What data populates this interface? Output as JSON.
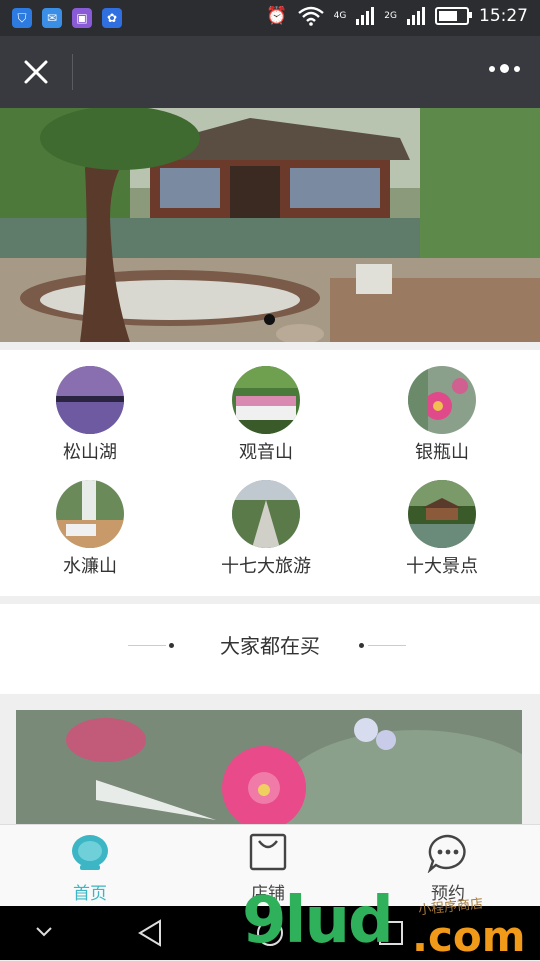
{
  "status_bar": {
    "time": "15:27",
    "network_1": "4G",
    "network_2": "2G",
    "battery_level": 0.75,
    "app_icons": [
      "shield-app-icon",
      "message-app-icon",
      "gallery-app-icon",
      "baidu-app-icon"
    ]
  },
  "title_bar": {
    "close_icon": "close-icon",
    "more_icon": "more-icon"
  },
  "banner": {
    "slide_count": 1,
    "active_slide": 1
  },
  "categories": [
    {
      "label": "松山湖",
      "icon": "lake-thumb"
    },
    {
      "label": "观音山",
      "icon": "mountain-pavilion-thumb"
    },
    {
      "label": "银瓶山",
      "icon": "flower-thumb"
    },
    {
      "label": "水濂山",
      "icon": "waterfall-thumb"
    },
    {
      "label": "十七大旅游",
      "icon": "park-aerial-thumb"
    },
    {
      "label": "十大景点",
      "icon": "garden-pavilion-thumb"
    }
  ],
  "section": {
    "title": "大家都在买"
  },
  "tabbar": {
    "tabs": [
      {
        "label": "首页",
        "icon": "home-icon",
        "active": true
      },
      {
        "label": "店铺",
        "icon": "bag-icon",
        "active": false
      },
      {
        "label": "预约",
        "icon": "chat-icon",
        "active": false
      }
    ],
    "active_color": "#3cb6c4",
    "inactive_color": "#444444"
  },
  "watermark": {
    "brand": "9lud",
    "domain": ".com",
    "tagline": "小程序商店"
  },
  "colors": {
    "status_bar_bg": "#2c2d30",
    "title_bar_bg": "#393a3f",
    "page_bg": "#efefef"
  }
}
